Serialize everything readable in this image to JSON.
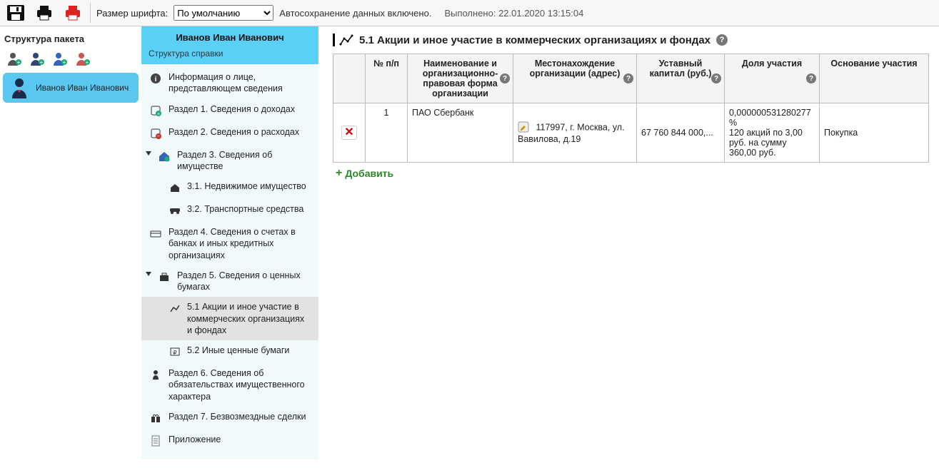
{
  "toolbar": {
    "font_label": "Размер шрифта:",
    "font_value": "По умолчанию",
    "autosave": "Автосохранение данных включено.",
    "completed": "Выполнено: 22.01.2020 13:15:04"
  },
  "leftcol": {
    "title": "Структура пакета",
    "person_name": "Иванов Иван Иванович"
  },
  "tree": {
    "header": "Иванов Иван Иванович",
    "subtitle": "Структура справки",
    "items": {
      "info": "Информация о лице, представляющем сведения",
      "s1": "Раздел 1. Сведения о доходах",
      "s2": "Раздел 2. Сведения о расходах",
      "s3": "Раздел 3. Сведения об имуществе",
      "s31": "3.1. Недвижимое имущество",
      "s32": "3.2. Транспортные средства",
      "s4": "Раздел 4. Сведения о счетах в банках и иных кредитных организациях",
      "s5": "Раздел 5. Сведения о ценных бумагах",
      "s51": "5.1 Акции и иное участие в коммерческих организациях и фондах",
      "s52": "5.2 Иные ценные бумаги",
      "s6": "Раздел 6. Сведения об обязательствах имущественного характера",
      "s7": "Раздел 7. Безвозмездные сделки",
      "app": "Приложение"
    }
  },
  "main": {
    "title": "5.1 Акции и иное участие в коммерческих организациях и фондах",
    "add_label": "Добавить",
    "headers": {
      "num": "№ п/п",
      "name": "Наименование и организационно-правовая форма организации",
      "addr": "Местонахождение организации (адрес)",
      "capital": "Уставный капитал (руб.)",
      "share": "Доля участия",
      "basis": "Основание участия"
    },
    "rows": [
      {
        "num": "1",
        "name": "ПАО Сбербанк",
        "addr": "117997, г. Москва, ул. Вавилова, д.19",
        "capital": "67 760 844 000,...",
        "share": "0,000000531280277 %\n120 акций по 3,00  руб. на сумму 360,00 руб.",
        "basis": "Покупка"
      }
    ]
  }
}
